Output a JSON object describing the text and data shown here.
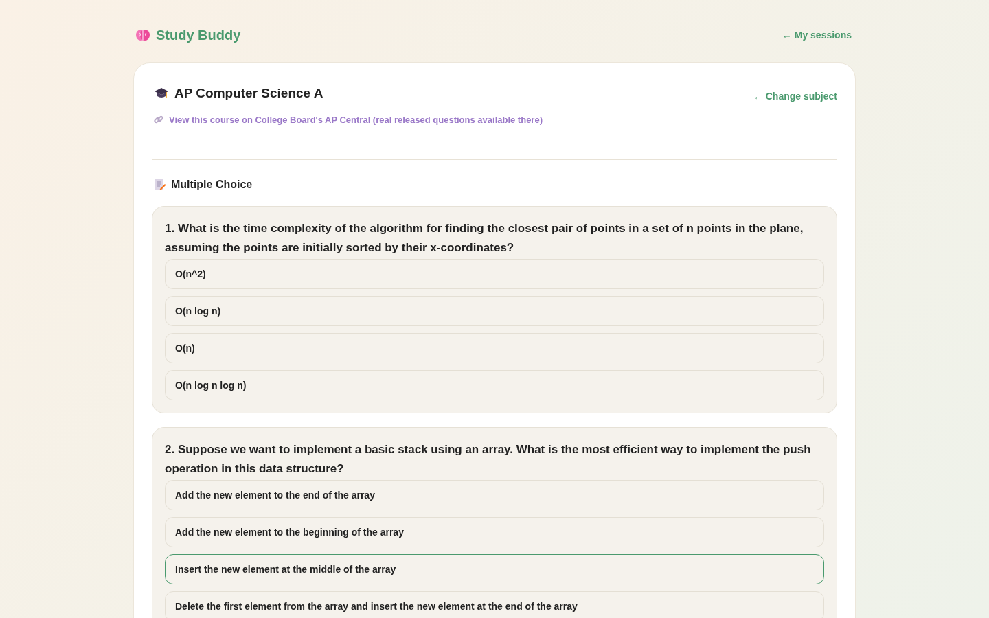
{
  "header": {
    "brand": "Study Buddy",
    "sessions_link": "← My sessions"
  },
  "course": {
    "title": "AP Computer Science A",
    "change_link": "← Change subject",
    "central_link": "View this course on College Board's AP Central (real released questions available there)"
  },
  "section": {
    "title": "Multiple Choice"
  },
  "questions": [
    {
      "prompt": "1. What is the time complexity of the algorithm for finding the closest pair of points in a set of n points in the plane, assuming the points are initially sorted by their x-coordinates?",
      "options": [
        {
          "text": "O(n^2)",
          "selected": false
        },
        {
          "text": "O(n log n)",
          "selected": false
        },
        {
          "text": "O(n)",
          "selected": false
        },
        {
          "text": "O(n log n log n)",
          "selected": false
        }
      ]
    },
    {
      "prompt": "2. Suppose we want to implement a basic stack using an array. What is the most efficient way to implement the push operation in this data structure?",
      "options": [
        {
          "text": "Add the new element to the end of the array",
          "selected": false
        },
        {
          "text": "Add the new element to the beginning of the array",
          "selected": false
        },
        {
          "text": "Insert the new element at the middle of the array",
          "selected": true
        },
        {
          "text": "Delete the first element from the array and insert the new element at the end of the array",
          "selected": false
        }
      ]
    }
  ]
}
